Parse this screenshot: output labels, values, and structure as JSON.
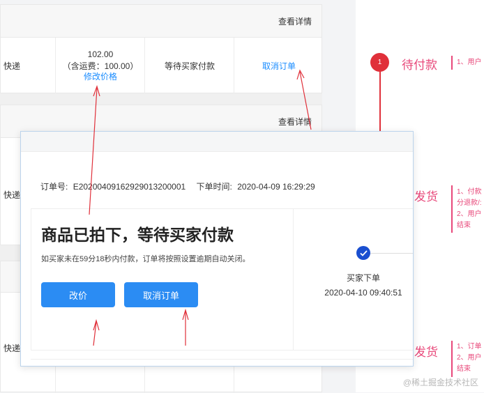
{
  "orders": [
    {
      "detail_label": "查看详情",
      "shipping": "快递",
      "price": "102.00",
      "price_note": "（含运费：100.00）",
      "edit_price": "修改价格",
      "status": "等待买家付款",
      "action": "取消订单"
    },
    {
      "detail_label": "查看详情",
      "shipping": "快递"
    },
    {
      "shipping": "快递"
    }
  ],
  "modal": {
    "order_no_label": "订单号:",
    "order_no": "E20200409162929013200001",
    "order_time_label": "下单时间:",
    "order_time": "2020-04-09 16:29:29",
    "headline": "商品已拍下，等待买家付款",
    "description": "如买家未在59分18秒内付款，订单将按照设置逾期自动关闭。",
    "change_price_button": "改价",
    "cancel_order_button": "取消订单",
    "step_title": "买家下单",
    "step_time": "2020-04-10 09:40:51"
  },
  "status_flow": {
    "step_number": "1",
    "step1_label": "待付款",
    "step1_note": "1、用户",
    "step2_label": "发货",
    "step2_notes": [
      "1、付款",
      "分退款/:",
      "2、用户",
      "结束"
    ],
    "step3_label": "发货",
    "step3_notes": [
      "1、订单",
      "2、用户",
      "结束"
    ]
  },
  "colors": {
    "accent": "#2b8cf3",
    "link": "#1a8cff",
    "annotation": "#e8487a",
    "arrow": "#e0303a"
  },
  "watermark": "@稀土掘金技术社区"
}
